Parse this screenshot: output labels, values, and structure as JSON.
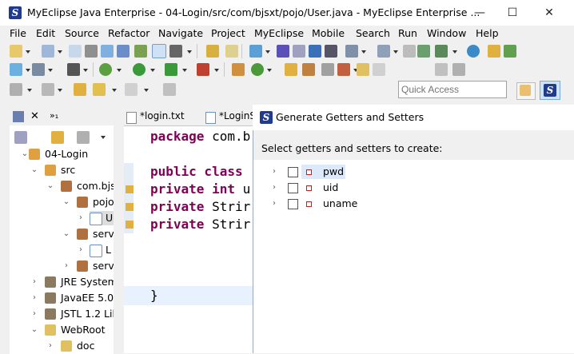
{
  "window": {
    "title": "MyEclipse Java Enterprise - 04-Login/src/com/bjsxt/pojo/User.java - MyEclipse Enterprise ...",
    "minimize": "—",
    "maximize": "☐",
    "close": "✕"
  },
  "menu": [
    "File",
    "Edit",
    "Source",
    "Refactor",
    "Navigate",
    "Project",
    "MyEclipse",
    "Mobile",
    "Search",
    "Run",
    "Window",
    "Help"
  ],
  "quick_access": {
    "placeholder": "Quick Access"
  },
  "left_panel": {
    "tab_label": "»₁",
    "tree": [
      {
        "label": "04-Login"
      },
      {
        "label": "src"
      },
      {
        "label": "com.bjs"
      },
      {
        "label": "pojo"
      },
      {
        "label": "U"
      },
      {
        "label": "servi"
      },
      {
        "label": "L"
      },
      {
        "label": "servl"
      },
      {
        "label": "JRE System"
      },
      {
        "label": "JavaEE 5.0"
      },
      {
        "label": "JSTL 1.2 Lib"
      },
      {
        "label": "WebRoot"
      },
      {
        "label": "doc"
      }
    ]
  },
  "editor": {
    "tabs": [
      "*login.txt",
      "*LoginS"
    ],
    "lines": [
      {
        "kw": "package",
        "rest": " com.b"
      },
      {
        "kw": "public class",
        "rest": " "
      },
      {
        "kw": "private int",
        "rest": " u"
      },
      {
        "kw": "private",
        "rest": " Strir"
      },
      {
        "kw": "private",
        "rest": " Strir"
      },
      {
        "kw": "",
        "rest": "}"
      }
    ]
  },
  "dialog": {
    "title": "Generate Getters and Setters",
    "prompt": "Select getters and setters to create:",
    "fields": [
      "pwd",
      "uid",
      "uname"
    ]
  }
}
